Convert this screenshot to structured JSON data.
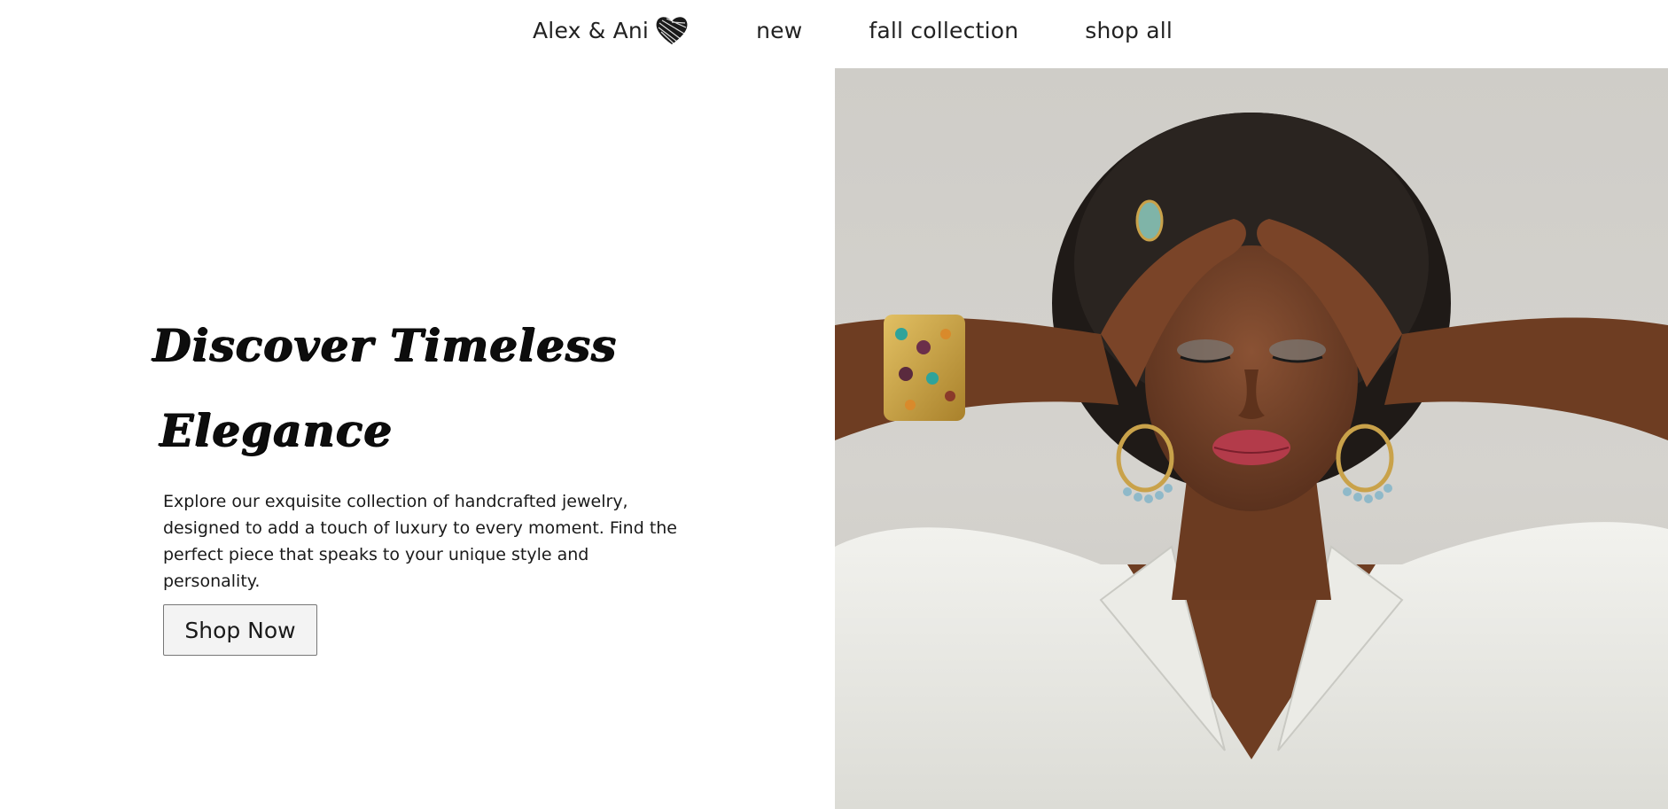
{
  "nav": {
    "brand": "Alex & Ani",
    "brand_icon": "heart-icon",
    "links": [
      {
        "label": "new"
      },
      {
        "label": "fall collection"
      },
      {
        "label": "shop all"
      }
    ]
  },
  "hero": {
    "headline_line1": "Discover Timeless",
    "headline_line2": "Elegance",
    "description": "Explore our exquisite collection of handcrafted jewelry, designed to add a touch of luxury to every moment. Find the perfect piece that speaks to your unique style and personality.",
    "cta_label": "Shop Now",
    "image_alt": "model-wearing-jewelry-photo"
  },
  "colors": {
    "text": "#1a1a1a",
    "button_bg": "#f3f3f3",
    "button_border": "#777777",
    "photo_bg": "#cfcdc8"
  }
}
